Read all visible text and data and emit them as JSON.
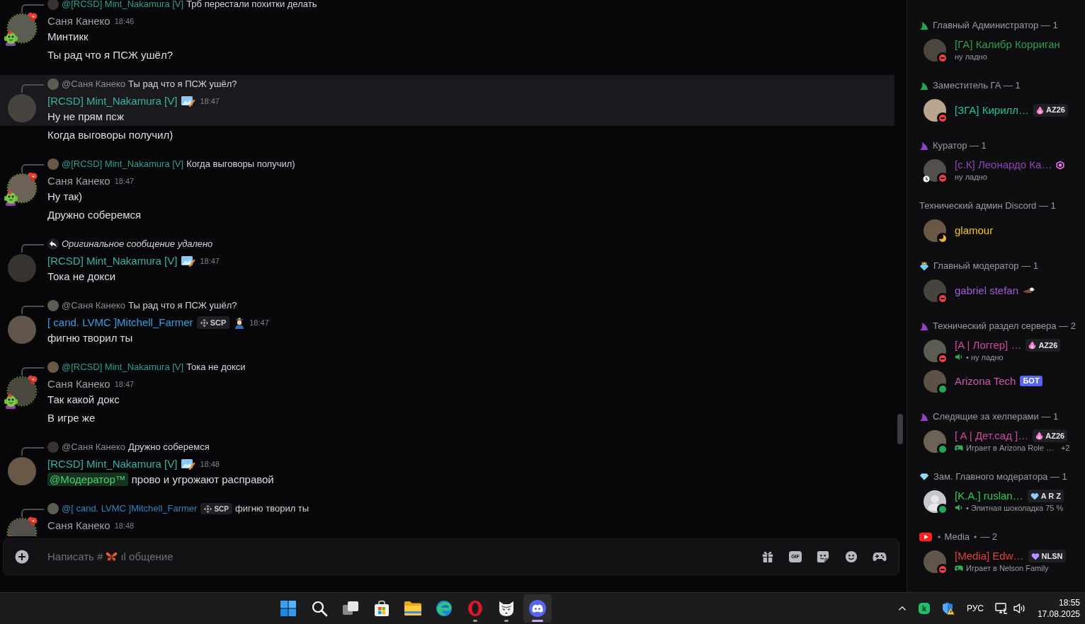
{
  "chat": {
    "messages": [
      {
        "reply": {
          "kind": "user",
          "author": "@[RCSD] Mint_Nakamura [V]",
          "color": "#2f9c90",
          "text": "Трб перестали похитки делать"
        },
        "author": "Саня Канеко",
        "color": "#a0a0a6",
        "decorated": true,
        "time": "18:46",
        "hovered": false,
        "lines": [
          {
            "text": "Минтикк"
          },
          {
            "text": "Ты рад что я ПСЖ ушёл?"
          }
        ]
      },
      {
        "reply": {
          "kind": "user",
          "author": "@Саня Канеко",
          "color": "#8a8a90",
          "text": "Ты рад что я ПСЖ ушёл?"
        },
        "author": "[RCSD] Mint_Nakamura [V]",
        "color": "#38b2a3",
        "decorated": false,
        "badges": [
          {
            "kind": "role-icon"
          }
        ],
        "time": "18:47",
        "hovered": true,
        "lines": [
          {
            "text": "Ну не прям псж"
          },
          {
            "text": "Когда выговоры получил)"
          }
        ]
      },
      {
        "reply": {
          "kind": "user",
          "author": "@[RCSD] Mint_Nakamura [V]",
          "color": "#2f9c90",
          "text": "Когда выговоры получил)"
        },
        "author": "Саня Канеко",
        "color": "#a0a0a6",
        "decorated": true,
        "time": "18:47",
        "hovered": false,
        "lines": [
          {
            "text": "Ну так)"
          },
          {
            "text": "Дружно соберемся"
          }
        ]
      },
      {
        "reply": {
          "kind": "deleted",
          "text": "Оригинальное сообщение удалено"
        },
        "author": "[RCSD] Mint_Nakamura [V]",
        "color": "#38b2a3",
        "decorated": false,
        "badges": [
          {
            "kind": "role-icon"
          }
        ],
        "time": "18:47",
        "hovered": false,
        "lines": [
          {
            "text": "Тока не докси"
          }
        ]
      },
      {
        "reply": {
          "kind": "user",
          "author": "@Саня Канеко",
          "color": "#8a8a90",
          "text": "Ты рад что я ПСЖ ушёл?"
        },
        "author": "[ cand. LVMC ]Mitchell_Farmer",
        "color": "#3a9ee0",
        "decorated": false,
        "badges": [
          {
            "kind": "tag",
            "label": "SCP"
          },
          {
            "kind": "officer"
          }
        ],
        "time": "18:47",
        "hovered": false,
        "lines": [
          {
            "text": "фигню творил ты"
          }
        ]
      },
      {
        "reply": {
          "kind": "user",
          "author": "@[RCSD] Mint_Nakamura [V]",
          "color": "#2f9c90",
          "text": "Тока не докси"
        },
        "author": "Саня Канеко",
        "color": "#a0a0a6",
        "decorated": true,
        "time": "18:47",
        "hovered": false,
        "lines": [
          {
            "text": "Так какой докс"
          },
          {
            "text": "В игре же"
          }
        ]
      },
      {
        "reply": {
          "kind": "user",
          "author": "@Саня Канеко",
          "color": "#8a8a90",
          "text": "Дружно соберемся"
        },
        "author": "[RCSD] Mint_Nakamura [V]",
        "color": "#38b2a3",
        "decorated": false,
        "badges": [
          {
            "kind": "role-icon"
          }
        ],
        "time": "18:48",
        "hovered": false,
        "lines": [
          {
            "mention": "@Модератор™",
            "text": "прово и угрожают расправой"
          }
        ]
      },
      {
        "reply": {
          "kind": "user",
          "author": "@[ cand. LVMC ]Mitchell_Farmer",
          "color": "#2f84bd",
          "tag": "SCP",
          "text": "фигню творил ты"
        },
        "author": "Саня Канеко",
        "color": "#a0a0a6",
        "decorated": true,
        "time": "18:48",
        "hovered": false
      }
    ]
  },
  "composer": {
    "placeholder": "Написать #",
    "channel": {
      "emoji": {
        "kind": "butterfly"
      },
      "name": "ıl общение"
    },
    "actions": [
      {
        "kind": "gift"
      },
      {
        "kind": "gif",
        "label": "GIF"
      },
      {
        "kind": "sticker"
      },
      {
        "kind": "emoji"
      },
      {
        "kind": "activities"
      }
    ]
  },
  "member_list": {
    "sections": [
      {
        "icon": {
          "kind": "sail",
          "color": "#27a354"
        },
        "title": "Главный Администратор — 1",
        "members": [
          {
            "name": "[ГА] Калибр Корриган",
            "color": "#2f9e4f",
            "avatar": {
              "kind": "photo"
            },
            "status": {
              "kind": "dnd"
            },
            "activity": {
              "kind": "custom",
              "text": "ну ладно"
            }
          }
        ]
      },
      {
        "icon": {
          "kind": "sail",
          "color": "#27a354"
        },
        "title": "Заместитель ГА — 1",
        "members": [
          {
            "name": "[ЗГА] Кирилл…",
            "color": "#22c69b",
            "avatar": {
              "kind": "photo"
            },
            "status": {
              "kind": "dnd"
            },
            "tag": {
              "kind": "flame",
              "color": "#f47fd0",
              "label": "AZ26"
            }
          }
        ]
      },
      {
        "icon": {
          "kind": "sail",
          "color": "#8e44c9"
        },
        "title": "Куратор — 1",
        "members": [
          {
            "name": "[с.К] Леонардо Ка…",
            "color": "#8b45b5",
            "avatar": {
              "kind": "photo"
            },
            "status": {
              "kind": "dnd"
            },
            "clock_badge": true,
            "emoji": {
              "kind": "gem"
            },
            "activity": {
              "kind": "custom",
              "text": "ну ладно"
            }
          }
        ]
      },
      {
        "title": "Технический админ Discord — 1",
        "members": [
          {
            "name": "glamour",
            "color": "#f0c419",
            "avatar": {
              "kind": "photo"
            },
            "status": {
              "kind": "idle"
            }
          }
        ]
      },
      {
        "icon": {
          "kind": "crown-diamond",
          "color": "#6fd0f5"
        },
        "title": "Главный модератор — 1",
        "members": [
          {
            "name": "gabriel stefan",
            "color": "#9f5ad6",
            "avatar": {
              "kind": "photo"
            },
            "status": {
              "kind": "dnd"
            },
            "emoji": {
              "kind": "eagle"
            }
          }
        ]
      },
      {
        "icon": {
          "kind": "sail",
          "color": "#8e44c9"
        },
        "title": "Технический раздел сервера — 2",
        "members": [
          {
            "name": "[A | Логгер] …",
            "color": "#d0479b",
            "avatar": {
              "kind": "photo"
            },
            "status": {
              "kind": "dnd"
            },
            "tag": {
              "kind": "flame",
              "color": "#f47fd0",
              "label": "AZ26"
            },
            "activity": {
              "kind": "voice",
              "text": "• ну ладно"
            }
          },
          {
            "name": "Arizona Tech",
            "color": "#c65aa9",
            "avatar": {
              "kind": "photo"
            },
            "status": {
              "kind": "online"
            },
            "bot_badge": "БОТ"
          }
        ]
      },
      {
        "icon": {
          "kind": "sail",
          "color": "#8e44c9"
        },
        "title": "Следящие за хелперами — 1",
        "members": [
          {
            "name": "[ A | Дет.сад ]…",
            "color": "#d0479b",
            "avatar": {
              "kind": "photo"
            },
            "status": {
              "kind": "online"
            },
            "tag": {
              "kind": "flame",
              "color": "#f47fd0",
              "label": "AZ26"
            },
            "activity": {
              "kind": "game",
              "text": "Играет в Arizona Role …",
              "extra": "+2"
            }
          }
        ]
      },
      {
        "icon": {
          "kind": "diamond",
          "color": "#8fd8f8"
        },
        "title": "Зам. Главного модератора — 1",
        "members": [
          {
            "name": "[K.A.] ruslan…",
            "color": "#30c85a",
            "avatar": {
              "kind": "default"
            },
            "status": {
              "kind": "online"
            },
            "tag": {
              "kind": "heart",
              "color": "#8fc8ff",
              "label": "A R Z"
            },
            "activity": {
              "kind": "voice",
              "text": "• Элитная шоколадка 75 %"
            }
          }
        ]
      },
      {
        "icon": {
          "kind": "video",
          "color": "#ff1f1f"
        },
        "title": "⋆ Media ⋆ — 2",
        "members": [
          {
            "name": "[Media] Edw…",
            "color": "#e2403a",
            "avatar": {
              "kind": "photo"
            },
            "status": {
              "kind": "dnd"
            },
            "tag": {
              "kind": "heart",
              "color": "#b98cff",
              "label": "NLSN"
            },
            "activity": {
              "kind": "game",
              "text": "Играет в Nelson Family"
            }
          }
        ]
      }
    ]
  },
  "taskbar": {
    "apps": [
      {
        "kind": "start",
        "running": false,
        "selected": false
      },
      {
        "kind": "search",
        "running": false,
        "selected": false
      },
      {
        "kind": "taskview",
        "running": false,
        "selected": false
      },
      {
        "kind": "store",
        "running": false,
        "selected": false
      },
      {
        "kind": "explorer",
        "running": false,
        "selected": false
      },
      {
        "kind": "edge",
        "running": false,
        "selected": false
      },
      {
        "kind": "opera",
        "running": true,
        "selected": false
      },
      {
        "kind": "cat",
        "running": true,
        "selected": false
      },
      {
        "kind": "discord",
        "running": true,
        "selected": true
      }
    ],
    "tray": {
      "icons": [
        {
          "kind": "chevron"
        },
        {
          "kind": "antivirus",
          "label": "k"
        },
        {
          "kind": "defender"
        }
      ],
      "language": "РУС",
      "status_icons": [
        {
          "kind": "network"
        },
        {
          "kind": "volume"
        }
      ],
      "time": "18:55",
      "date": "17.08.2025"
    }
  }
}
